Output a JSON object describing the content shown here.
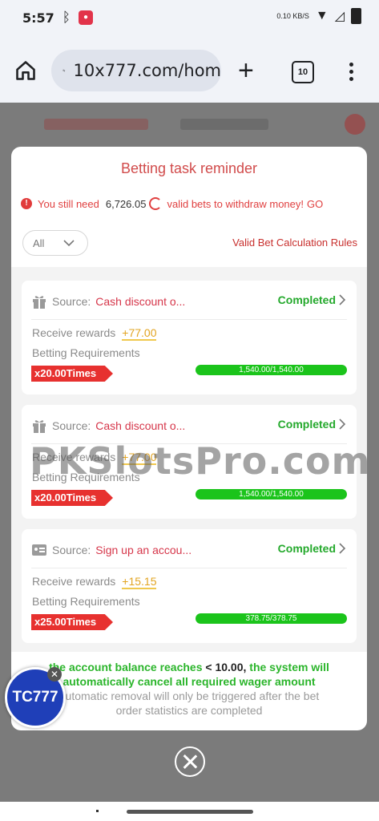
{
  "status_bar": {
    "time": "5:57",
    "net_speed": "0.10 KB/S"
  },
  "browser": {
    "url": "10x777.com/hom",
    "tab_count": "10"
  },
  "modal": {
    "title": "Betting task reminder",
    "notice": {
      "prefix": "You still need",
      "amount": "6,726.05",
      "suffix": "valid bets to withdraw money!",
      "go": "GO"
    },
    "filter": {
      "value": "All"
    },
    "rules_link": "Valid Bet Calculation Rules",
    "cards": [
      {
        "source_label": "Source:",
        "source_value": "Cash discount o...",
        "status": "Completed",
        "rewards_label": "Receive rewards",
        "rewards_value": "+77.00",
        "req_label": "Betting Requirements",
        "multiplier": "x20.00Times",
        "progress_text": "1,540.00/1,540.00",
        "progress": 1.0
      },
      {
        "source_label": "Source:",
        "source_value": "Cash discount o...",
        "status": "Completed",
        "rewards_label": "Receive rewards",
        "rewards_value": "+77.00",
        "req_label": "Betting Requirements",
        "multiplier": "x20.00Times",
        "progress_text": "1,540.00/1,540.00",
        "progress": 1.0
      },
      {
        "source_label": "Source:",
        "source_value": "Sign up an accou...",
        "status": "Completed",
        "rewards_label": "Receive rewards",
        "rewards_value": "+15.15",
        "req_label": "Betting Requirements",
        "multiplier": "x25.00Times",
        "progress_text": "378.75/378.75",
        "progress": 1.0
      }
    ],
    "footer": {
      "line1_a": "the account balance reaches",
      "line1_b": "< 10.00,",
      "line1_c": "the system will",
      "line2": "automatically cancel all required wager amount",
      "line3": "automatic removal will only be triggered after the bet",
      "line4": "order statistics are completed"
    }
  },
  "watermark": "PKSlotsPro.com",
  "floating_badge": "TC777"
}
